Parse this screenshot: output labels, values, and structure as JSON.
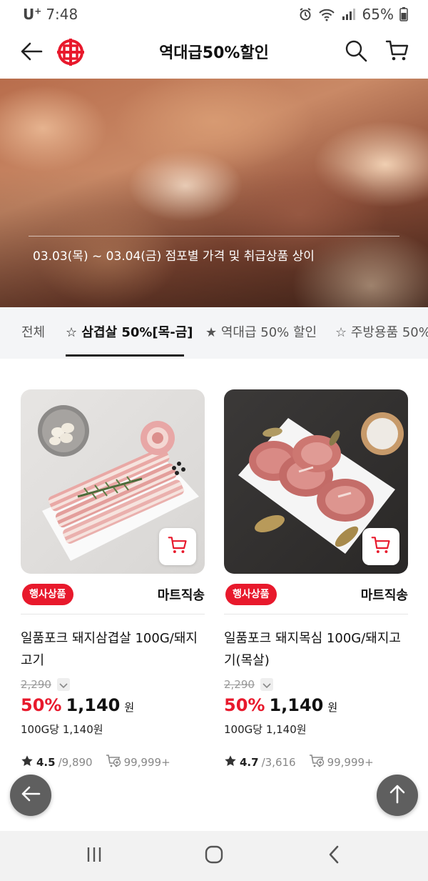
{
  "status_bar": {
    "carrier": "U",
    "carrier_sup": "+",
    "time": "7:48",
    "battery": "65%",
    "icons": [
      "alarm-icon",
      "wifi-icon",
      "signal-icon",
      "battery-icon"
    ]
  },
  "header": {
    "title": "역대급50%할인",
    "back_icon": "back-arrow-icon",
    "logo_icon": "brand-logo-icon",
    "search_icon": "search-icon",
    "cart_icon": "cart-icon",
    "brand_color": "#e8192c"
  },
  "banner": {
    "notice": "03.03(목) ~ 03.04(금) 점포별 가격 및 취급상품 상이"
  },
  "tabs": [
    {
      "label": "전체",
      "active": false
    },
    {
      "label": "☆ 삼겹살 50%[목-금]",
      "active": true
    },
    {
      "label": "★ 역대급 50% 할인",
      "active": false
    },
    {
      "label": "☆ 주방용품 50%",
      "active": false
    }
  ],
  "products": [
    {
      "badge": "행사상품",
      "delivery": "마트직송",
      "name": "일품포크 돼지삼겹살 100G/돼지고기",
      "original_price": "2,290",
      "discount": "50%",
      "price": "1,140",
      "currency": "원",
      "unit_price": "100G당 1,140원",
      "rating": "4.5",
      "reviews": "/9,890",
      "sales": "99,999+"
    },
    {
      "badge": "행사상품",
      "delivery": "마트직송",
      "name": "일품포크 돼지목심 100G/돼지고기(목살)",
      "original_price": "2,290",
      "discount": "50%",
      "price": "1,140",
      "currency": "원",
      "unit_price": "100G당 1,140원",
      "rating": "4.7",
      "reviews": "/3,616",
      "sales": "99,999+"
    }
  ],
  "floating": {
    "back_icon": "arrow-left-icon",
    "top_icon": "arrow-up-icon"
  },
  "nav_bar": {
    "icons": [
      "recent-apps-icon",
      "home-icon",
      "back-icon"
    ]
  }
}
